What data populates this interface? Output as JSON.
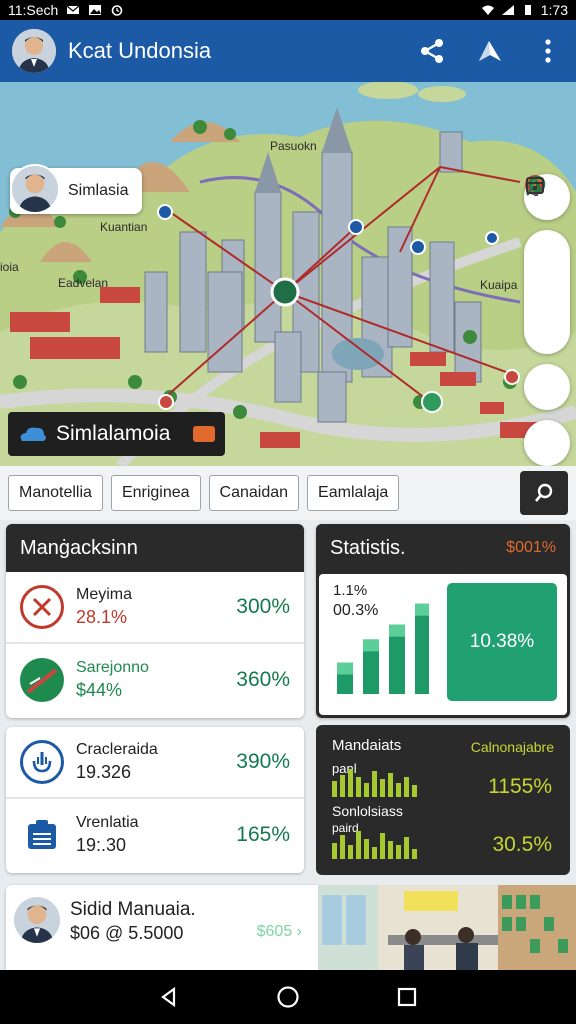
{
  "status_bar": {
    "time": "11:Sech",
    "clock_right": "1:73"
  },
  "app_bar": {
    "title": "Kcat Undonsia",
    "share_icon": "share-icon",
    "nav_icon": "navigation-icon",
    "more_icon": "more-vert-icon"
  },
  "map": {
    "chip_label": "Simlasia",
    "labels": [
      "Pasuokn",
      "Kuantian",
      "ioia",
      "Eadvelan",
      "Kuaipa"
    ],
    "banner_text": "Simlalamoia"
  },
  "map_controls": [
    "arrow-up-icon",
    "pin-icon",
    "shirt-icon",
    "leaf-icon",
    "search-zoom-icon",
    "calendar-icon"
  ],
  "tabs": [
    "Manotellia",
    "Enriginea",
    "Canaidan",
    "Eamlalaja"
  ],
  "management": {
    "title": "Manġacksinn",
    "rows": [
      {
        "name": "Meyima",
        "sub": "28.1%",
        "pct": "300%",
        "icon": "cancel-icon",
        "sub_color": "#c0392b"
      },
      {
        "name": "Sarejonno",
        "sub": "$44%",
        "pct": "360%",
        "icon": "chart-trend-icon",
        "sub_color": "#1e8a4d"
      }
    ]
  },
  "statistics": {
    "title": "Statistis.",
    "badge": "$001%",
    "label_a": "1.1%",
    "label_b": "00.3%",
    "tile_value": "10.38%"
  },
  "chart_data": {
    "type": "bar",
    "categories": [
      "1",
      "2",
      "3",
      "4"
    ],
    "series": [
      {
        "values": [
          30,
          52,
          66,
          86
        ]
      }
    ],
    "ylim": [
      0,
      100
    ]
  },
  "activity": {
    "rows": [
      {
        "name": "Cracleraida",
        "sub": "19.326",
        "pct": "390%",
        "icon": "gauge-icon"
      },
      {
        "name": "Vrenlatia",
        "sub": "19:.30",
        "pct": "165%",
        "icon": "clipboard-icon"
      }
    ]
  },
  "metrics": {
    "title": "Mandaiats",
    "title_right": "Calnonajabre",
    "row1_label": "panl",
    "row1_value": "1155%",
    "row2_label": "Sonlolsiass",
    "row2_sublabel": "paird",
    "row2_value": "30.5%"
  },
  "profile": {
    "name": "Sidid Manuaia.",
    "sub": "$06 @ 5.5000",
    "link": "$605 ›"
  }
}
